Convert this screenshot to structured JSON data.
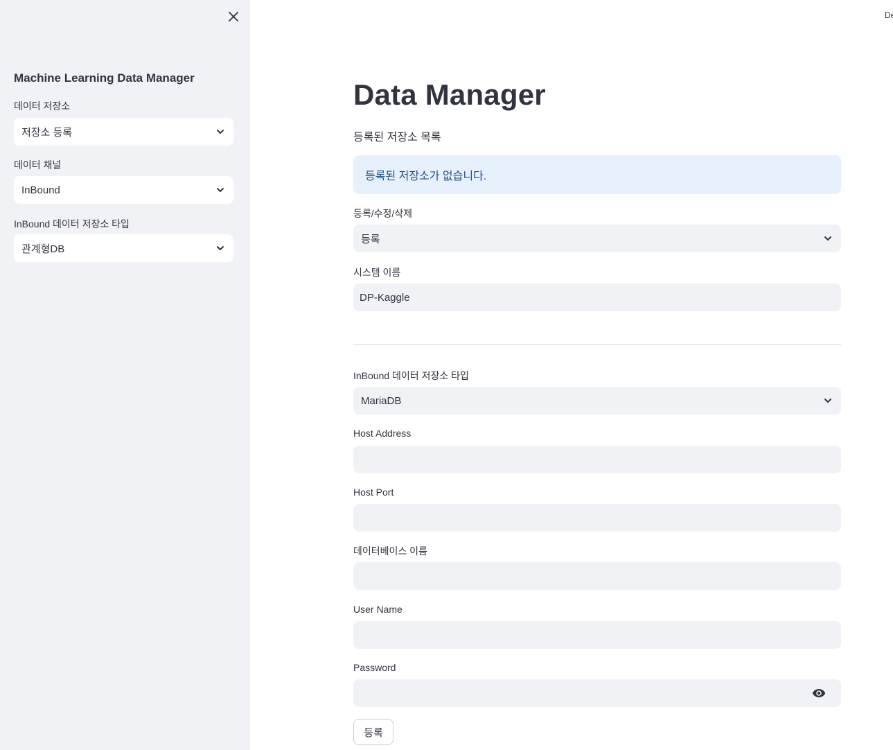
{
  "sidebar": {
    "title": "Machine Learning Data Manager",
    "fields": [
      {
        "label": "데이터 저장소",
        "value": "저장소 등록"
      },
      {
        "label": "데이터 채널",
        "value": "InBound"
      },
      {
        "label": "InBound 데이터 저장소 타입",
        "value": "관계형DB"
      }
    ]
  },
  "header": {
    "deploy_label": "Deploy"
  },
  "main": {
    "title": "Data Manager",
    "subheading": "등록된 저장소 목록",
    "info_message": "등록된 저장소가 없습니다.",
    "action": {
      "label": "등록/수정/삭제",
      "value": "등록"
    },
    "system_name": {
      "label": "시스템 이름",
      "value": "DP-Kaggle"
    },
    "storage_type": {
      "label": "InBound 데이터 저장소 타입",
      "value": "MariaDB"
    },
    "host_address": {
      "label": "Host Address",
      "value": ""
    },
    "host_port": {
      "label": "Host Port",
      "value": ""
    },
    "database_name": {
      "label": "데이터베이스 이름",
      "value": ""
    },
    "user_name": {
      "label": "User Name",
      "value": ""
    },
    "password": {
      "label": "Password",
      "value": ""
    },
    "submit_label": "등록"
  },
  "colors": {
    "sidebar_bg": "#f0f2f6",
    "input_bg": "#f0f2f6",
    "info_bg": "#e7f1fc",
    "info_text": "#1e4d8c",
    "text": "#31333f"
  },
  "icons": {
    "close": "close-icon",
    "chevron": "chevron-down-icon",
    "eye": "eye-icon"
  }
}
